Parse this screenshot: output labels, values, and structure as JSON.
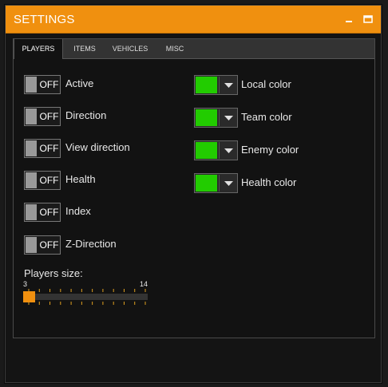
{
  "window": {
    "title": "SETTINGS"
  },
  "tabs": [
    "PLAYERS",
    "ITEMS",
    "VEHICLES",
    "MISC"
  ],
  "active_tab": "PLAYERS",
  "toggles": [
    {
      "state": "OFF",
      "label": "Active"
    },
    {
      "state": "OFF",
      "label": "Direction"
    },
    {
      "state": "OFF",
      "label": "View direction"
    },
    {
      "state": "OFF",
      "label": "Health"
    },
    {
      "state": "OFF",
      "label": "Index"
    },
    {
      "state": "OFF",
      "label": "Z-Direction"
    }
  ],
  "colors": [
    {
      "label": "Local color",
      "value": "#22cc00"
    },
    {
      "label": "Team color",
      "value": "#22cc00"
    },
    {
      "label": "Enemy color",
      "value": "#22cc00"
    },
    {
      "label": "Health color",
      "value": "#22cc00"
    }
  ],
  "slider": {
    "label": "Players size:",
    "min": "3",
    "max": "14",
    "value": 3
  },
  "theme": {
    "accent": "#f0900f"
  }
}
